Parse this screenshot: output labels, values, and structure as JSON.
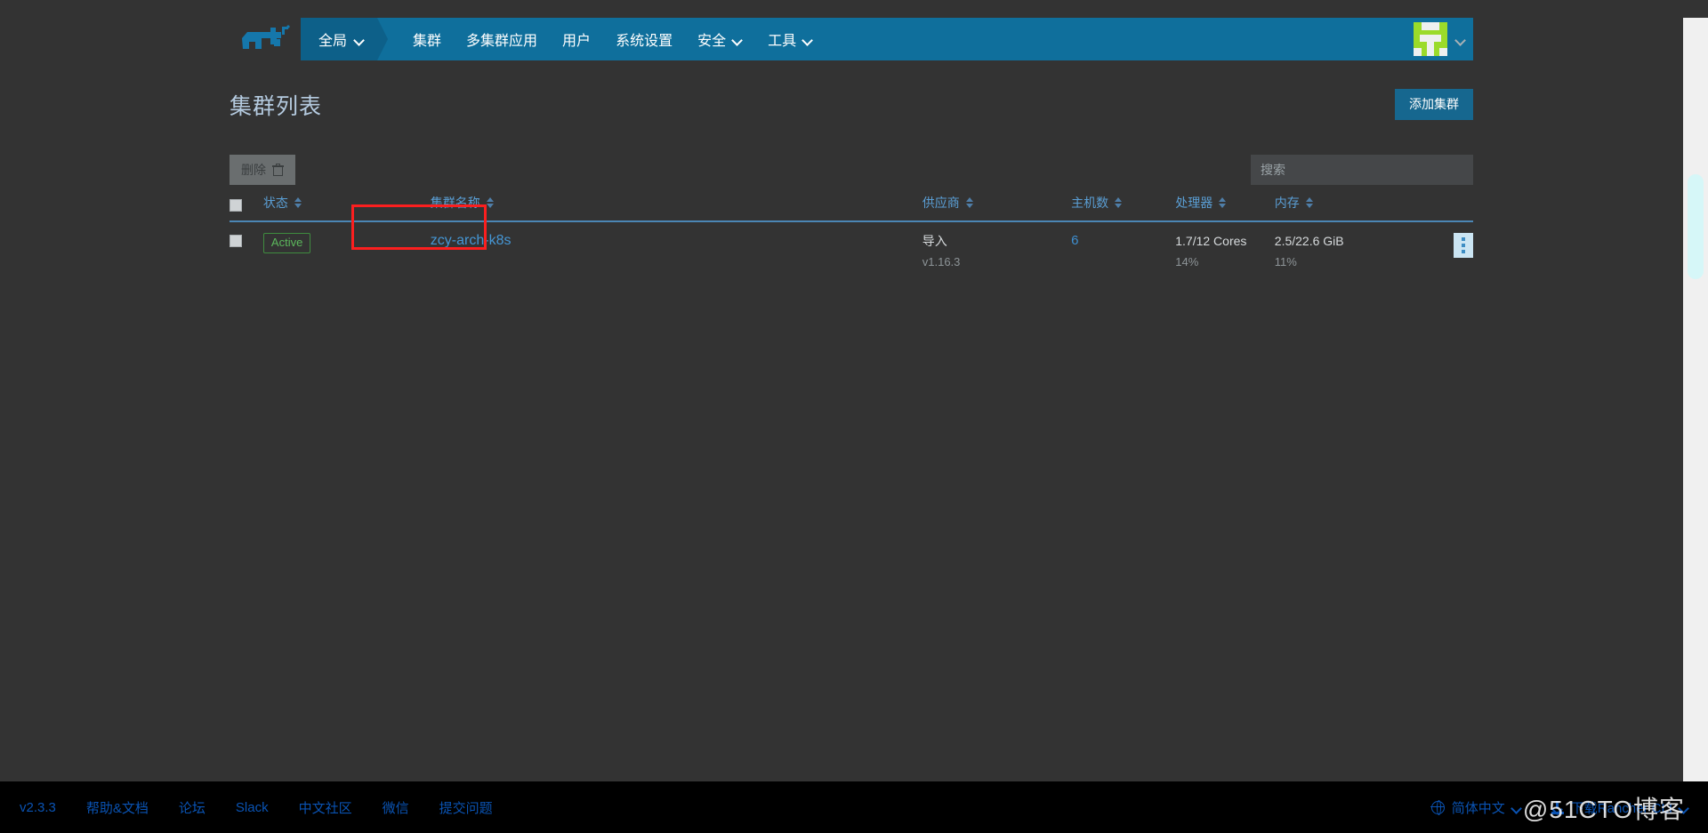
{
  "nav": {
    "logo_icon": "rancher-cow-logo",
    "global": {
      "label": "全局",
      "caret_icon": "chevron-down-icon"
    },
    "items": [
      {
        "label": "集群",
        "has_caret": false
      },
      {
        "label": "多集群应用",
        "has_caret": false
      },
      {
        "label": "用户",
        "has_caret": false
      },
      {
        "label": "系统设置",
        "has_caret": false
      },
      {
        "label": "安全",
        "has_caret": true
      },
      {
        "label": "工具",
        "has_caret": true
      }
    ],
    "avatar_icon": "user-avatar-icon",
    "user_caret_icon": "chevron-down-icon",
    "accent_color": "#0f6f9c",
    "active_color": "#0d6089"
  },
  "page": {
    "title": "集群列表",
    "add_cluster_label": "添加集群",
    "add_button_color": "#16678f"
  },
  "toolbar": {
    "delete_label": "删除",
    "delete_icon": "trash-icon",
    "delete_disabled": true,
    "search_placeholder": "搜索",
    "search_value": ""
  },
  "table": {
    "select_all_checked": false,
    "columns": [
      {
        "key": "checkbox",
        "label": "",
        "sortable": false
      },
      {
        "key": "state",
        "label": "状态",
        "sortable": true
      },
      {
        "key": "name",
        "label": "集群名称",
        "sortable": true
      },
      {
        "key": "provider",
        "label": "供应商",
        "sortable": true
      },
      {
        "key": "nodes",
        "label": "主机数",
        "sortable": true
      },
      {
        "key": "cpu",
        "label": "处理器",
        "sortable": true
      },
      {
        "key": "memory",
        "label": "内存",
        "sortable": true
      },
      {
        "key": "actions",
        "label": "",
        "sortable": false
      }
    ],
    "rows": [
      {
        "checked": false,
        "state": "Active",
        "state_color": "#5cb85c",
        "name": "zcy-arch-k8s",
        "provider_main": "导入",
        "provider_sub": "v1.16.3",
        "nodes": "6",
        "cpu_main": "1.7/12 Cores",
        "cpu_sub": "14%",
        "memory_main": "2.5/22.6 GiB",
        "memory_sub": "11%",
        "actions_icon": "kebab-menu-icon"
      }
    ]
  },
  "annotation": {
    "type": "red-highlight-rectangle",
    "color": "#fb1f1f",
    "targets": "集群名称 / zcy-arch-k8s"
  },
  "footer": {
    "links": [
      {
        "label": "v2.3.3"
      },
      {
        "label": "帮助&文档"
      },
      {
        "label": "论坛"
      },
      {
        "label": "Slack"
      },
      {
        "label": "中文社区"
      },
      {
        "label": "微信"
      },
      {
        "label": "提交问题"
      }
    ],
    "language": {
      "label": "简体中文",
      "icon": "globe-icon",
      "caret_icon": "chevron-down-icon"
    },
    "cli": {
      "label": "下载Rancher CLI",
      "icon": "download-icon",
      "caret_icon": "chevron-down-icon"
    },
    "link_color": "#0a53b3"
  },
  "watermark": {
    "text": "@51CTO博客"
  }
}
